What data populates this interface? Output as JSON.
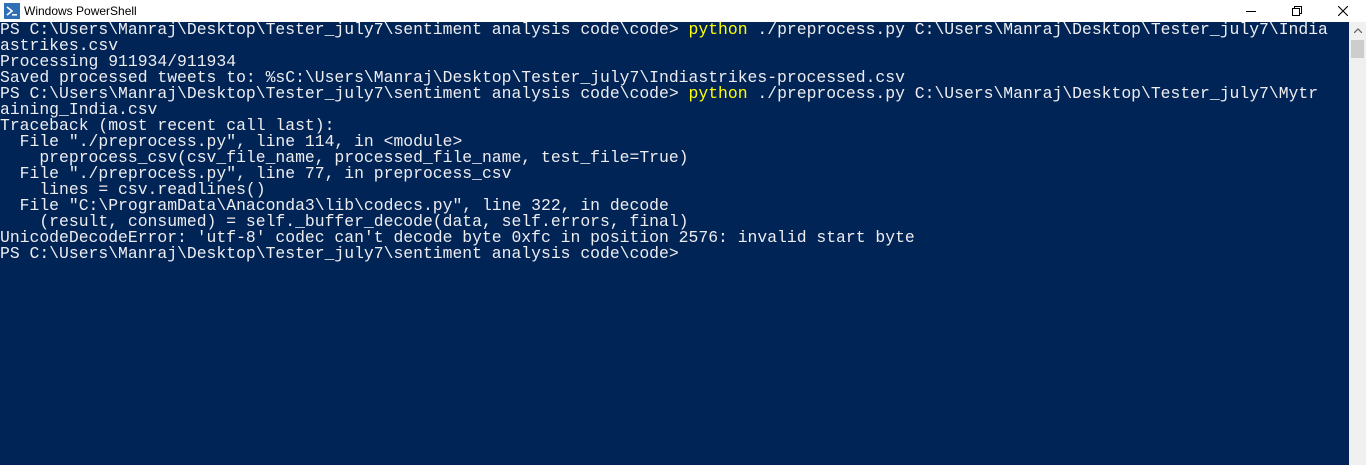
{
  "window": {
    "title": "Windows PowerShell",
    "icon": "powershell-icon",
    "controls": {
      "minimize_icon": "minimize-icon",
      "maximize_icon": "restore-icon",
      "close_icon": "close-icon"
    }
  },
  "colors": {
    "console_background": "#012456",
    "console_text": "#eeedf0",
    "command_highlight": "#ffff00",
    "titlebar_background": "#ffffff"
  },
  "console": {
    "lines": [
      {
        "prefix": "PS C:\\Users\\Manraj\\Desktop\\Tester_july7\\sentiment analysis code\\code> ",
        "cmd": "python",
        "rest": " ./preprocess.py C:\\Users\\Manraj\\Desktop\\Tester_july7\\India"
      },
      {
        "prefix": "",
        "cmd": "",
        "rest": "astrikes.csv"
      },
      {
        "prefix": "",
        "cmd": "",
        "rest": "Processing 911934/911934"
      },
      {
        "prefix": "",
        "cmd": "",
        "rest": "Saved processed tweets to: %sC:\\Users\\Manraj\\Desktop\\Tester_july7\\Indiastrikes-processed.csv"
      },
      {
        "prefix": "PS C:\\Users\\Manraj\\Desktop\\Tester_july7\\sentiment analysis code\\code> ",
        "cmd": "python",
        "rest": " ./preprocess.py C:\\Users\\Manraj\\Desktop\\Tester_july7\\Mytr"
      },
      {
        "prefix": "",
        "cmd": "",
        "rest": "aining_India.csv"
      },
      {
        "prefix": "",
        "cmd": "",
        "rest": "Traceback (most recent call last):"
      },
      {
        "prefix": "",
        "cmd": "",
        "rest": "  File \"./preprocess.py\", line 114, in <module>"
      },
      {
        "prefix": "",
        "cmd": "",
        "rest": "    preprocess_csv(csv_file_name, processed_file_name, test_file=True)"
      },
      {
        "prefix": "",
        "cmd": "",
        "rest": "  File \"./preprocess.py\", line 77, in preprocess_csv"
      },
      {
        "prefix": "",
        "cmd": "",
        "rest": "    lines = csv.readlines()"
      },
      {
        "prefix": "",
        "cmd": "",
        "rest": "  File \"C:\\ProgramData\\Anaconda3\\lib\\codecs.py\", line 322, in decode"
      },
      {
        "prefix": "",
        "cmd": "",
        "rest": "    (result, consumed) = self._buffer_decode(data, self.errors, final)"
      },
      {
        "prefix": "",
        "cmd": "",
        "rest": "UnicodeDecodeError: 'utf-8' codec can't decode byte 0xfc in position 2576: invalid start byte"
      },
      {
        "prefix": "PS C:\\Users\\Manraj\\Desktop\\Tester_july7\\sentiment analysis code\\code>",
        "cmd": "",
        "rest": ""
      }
    ]
  },
  "scrollbar": {
    "up_icon": "scroll-up-arrow-icon"
  }
}
